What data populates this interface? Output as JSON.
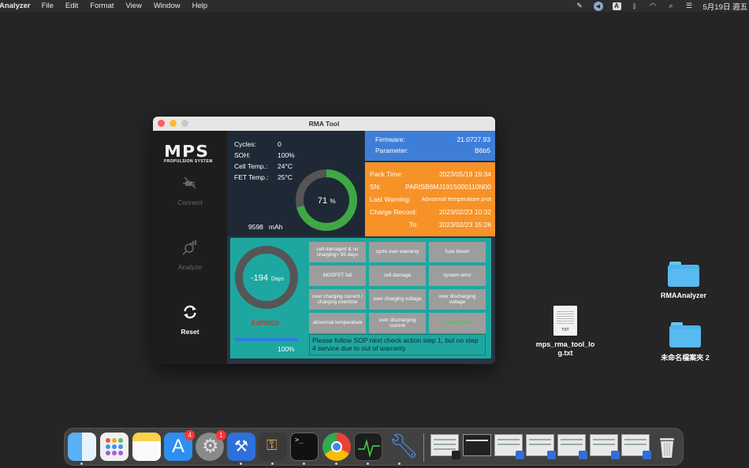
{
  "menubar": {
    "app_name": "Analyzer",
    "menus": [
      "File",
      "Edit",
      "Format",
      "View",
      "Window",
      "Help"
    ],
    "input_letter": "A",
    "clock": "5月19日 週五"
  },
  "window": {
    "title": "RMA Tool"
  },
  "sidebar": {
    "logo_text": "MPS",
    "logo_sub": "PROPULSION SYSTEM",
    "connect_label": "Connect",
    "analyze_label": "Analyze",
    "reset_label": "Reset"
  },
  "stats": {
    "cycles_label": "Cycles:",
    "cycles_value": "0",
    "soh_label": "SOH:",
    "soh_value": "100%",
    "cell_temp_label": "Cell Temp.:",
    "cell_temp_value": "24°C",
    "fet_temp_label": "FET Temp.:",
    "fet_temp_value": "25°C",
    "gauge_value": 71,
    "gauge_text": "71",
    "gauge_unit": "%",
    "capacity_value": "9598",
    "capacity_unit": "mAh"
  },
  "firmware": {
    "firmware_label": "Firmware:",
    "firmware_value": "21.0727.93",
    "parameter_label": "Parameter:",
    "parameter_value": "B6b5"
  },
  "pack": {
    "pack_time_label": "Pack Time:",
    "pack_time_value": "2023/05/19 19:34",
    "sn_label": "SN:",
    "sn_value": "PARISB6MJ1915000110N00",
    "warning_label": "Last Warning:",
    "warning_value": "Abnormal temperature prot",
    "charge_label": "Charge Record:",
    "charge_value": "2023/02/23 10:32",
    "to_label": "To:",
    "to_value": "2023/02/23 15:26"
  },
  "warranty": {
    "days_value": "-194",
    "days_unit": "Days",
    "status": "EXPIRED",
    "progress": 100,
    "progress_text": "100%"
  },
  "checks": [
    "cell damaged & no charging> 95 days",
    "cycle over warranty",
    "fuse blown",
    "MOSFET fail",
    "cell damage",
    "system error",
    "over charging current / charging overtime",
    "over charging voltage",
    "over discharging voltage",
    "abnormal temperature",
    "over discharging current",
    "battery good"
  ],
  "message": "Please follow SOP next check action step 1, but no step 4 service due to out of warranty",
  "desktop": {
    "folder1": "RMAAnalyzer",
    "file1": "mps_rma_tool_log.txt",
    "file1_tag": "TXT",
    "folder2": "未命名檔案夾 2"
  },
  "dock": {
    "appstore_badge": "4",
    "settings_badge": "1"
  },
  "colors": {
    "firmware_bg": "#3f7ed8",
    "pack_bg": "#f79226",
    "lower_bg": "#1ea7a0",
    "expired": "#d9302b",
    "gauge_green": "#3fa845"
  }
}
